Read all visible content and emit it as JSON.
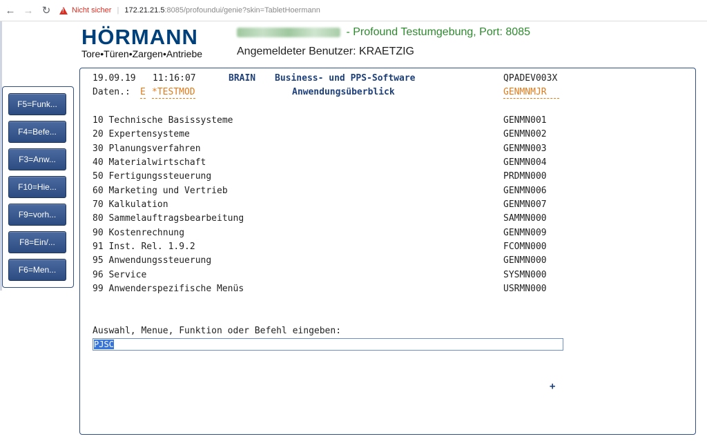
{
  "browser": {
    "security_label": "Nicht sicher",
    "separator": "|",
    "url_host": "172.21.21.5",
    "url_path": ":8085/profoundui/genie?skin=TabletHoermann"
  },
  "header": {
    "logo_text": "HÖRMANN",
    "logo_tagline": "Tore•Türen•Zargen•Antriebe",
    "title": "- Profound Testumgebung, Port: 8085",
    "user": "Angemeldeter Benutzer: KRAETZIG"
  },
  "fkeys": [
    {
      "label": "F5=Funk..."
    },
    {
      "label": "F4=Befe..."
    },
    {
      "label": "F3=Anw..."
    },
    {
      "label": "F10=Hie..."
    },
    {
      "label": "F9=vorh..."
    },
    {
      "label": "F8=Ein/..."
    },
    {
      "label": "F6=Men..."
    }
  ],
  "screen": {
    "date": "19.09.19",
    "time": "11:16:07",
    "brain": "BRAIN",
    "app_title": "Business- und PPS-Software",
    "system_id": "QPADEV003X",
    "daten_label": "Daten.:",
    "daten_code": "E",
    "daten_lib": "*TESTMOD",
    "subtitle": "Anwendungsüberblick",
    "menu_id": "GENMNMJR",
    "menu_items": [
      {
        "text": "10 Technische Basissysteme",
        "code": "GENMN001"
      },
      {
        "text": "20 Expertensysteme",
        "code": "GENMN002"
      },
      {
        "text": "30 Planungsverfahren",
        "code": "GENMN003"
      },
      {
        "text": "40 Materialwirtschaft",
        "code": "GENMN004"
      },
      {
        "text": "50 Fertigungssteuerung",
        "code": "PRDMN000"
      },
      {
        "text": "60 Marketing und Vertrieb",
        "code": "GENMN006"
      },
      {
        "text": "70 Kalkulation",
        "code": "GENMN007"
      },
      {
        "text": "80 Sammelauftragsbearbeitung",
        "code": "SAMMN000"
      },
      {
        "text": "90 Kostenrechnung",
        "code": "GENMN009"
      },
      {
        "text": "91 Inst. Rel. 1.9.2",
        "code": "FCOMN000"
      },
      {
        "text": "95 Anwendungssteuerung",
        "code": "GENMN000"
      },
      {
        "text": "96 Service",
        "code": "SYSMN000"
      },
      {
        "text": "99 Anwenderspezifische Menüs",
        "code": "USRMN000"
      }
    ],
    "prompt": "Auswahl, Menue, Funktion oder Befehl eingeben:",
    "input_value": "PJSC",
    "more_indicator": "+"
  }
}
